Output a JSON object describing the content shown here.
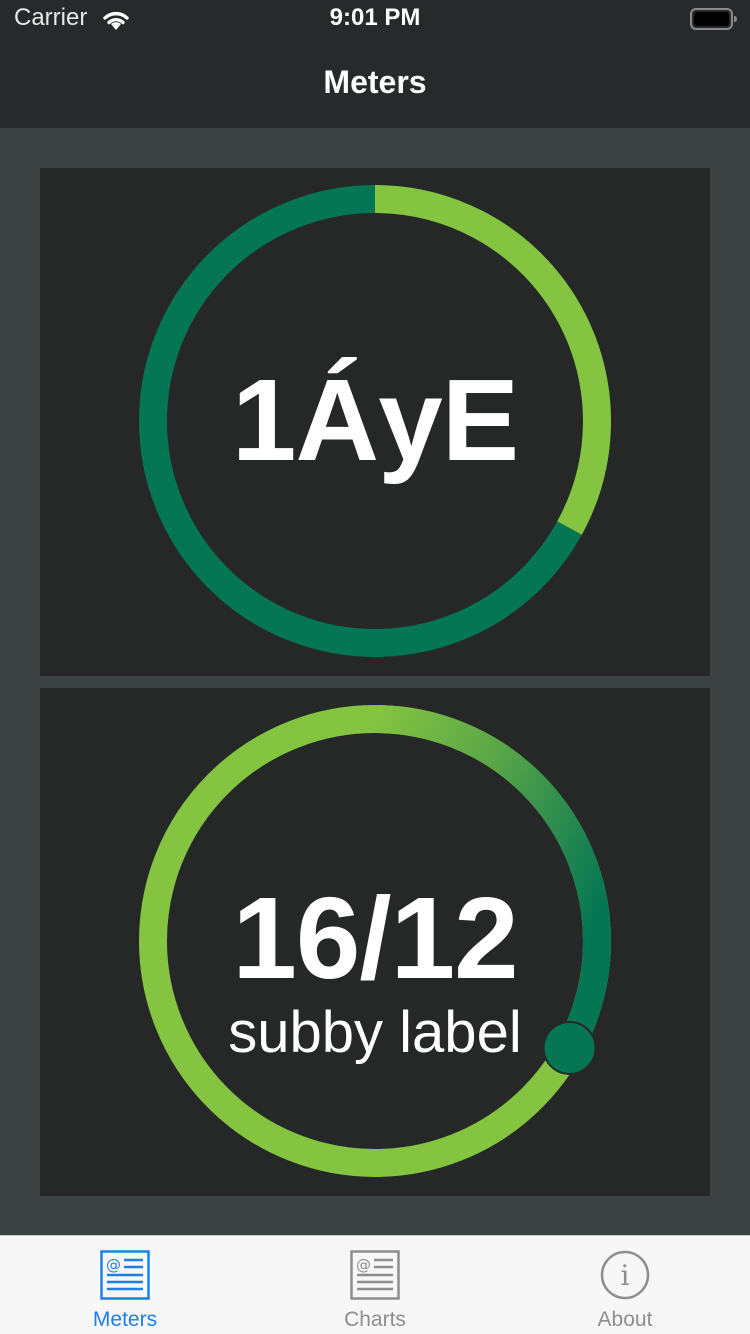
{
  "status_bar": {
    "carrier": "Carrier",
    "time": "9:01 PM",
    "icons": [
      "wifi-icon",
      "battery-icon"
    ]
  },
  "nav": {
    "title": "Meters"
  },
  "meters": [
    {
      "value_text": "1ÁyE",
      "subtitle": "",
      "progress": 0.33,
      "colors": {
        "track": "#047654",
        "fill": "#84c441"
      }
    },
    {
      "value_text": "16/12",
      "subtitle": "subby label",
      "progress": 1.33,
      "colors": {
        "track": "#84c441",
        "fill_start": "#84c441",
        "fill_end": "#047654",
        "knob": "#047654"
      }
    }
  ],
  "tabs": [
    {
      "label": "Meters",
      "icon": "meters-tab-icon",
      "active": true
    },
    {
      "label": "Charts",
      "icon": "charts-tab-icon",
      "active": false
    },
    {
      "label": "About",
      "icon": "about-tab-icon",
      "active": false
    }
  ],
  "theme": {
    "background": "#3c4141",
    "bar": "#262a2a",
    "card": "#262828",
    "accent": "#1e80e6",
    "inactive": "#8e8e8e"
  }
}
